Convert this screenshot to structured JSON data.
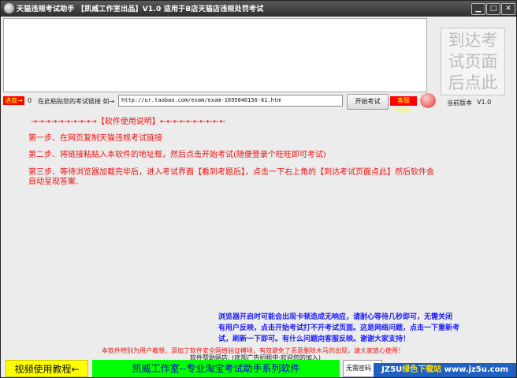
{
  "window": {
    "title": "天猫违规考试助手 【凯威工作室出品】V1.0 适用于B店天猫店违规处罚考试",
    "controls": {
      "minimize": "▁",
      "maximize": "□",
      "close": "✕"
    },
    "app_icon": "cat-app-icon"
  },
  "goto_button": {
    "label": "到达考试页面后点此"
  },
  "toolbar": {
    "progress_label": "进度→",
    "progress_value": "0",
    "paste_hint": "在此粘贴您的考试链接 如→",
    "url_value": "http://ur.taobao.com/exam/exam-1695046156-61.htm",
    "start_button": "开始考试",
    "support_label": "客服QQ→",
    "support_icon": "qq-penguin-icon",
    "version_label": "当前版本",
    "version_value": "V1.0"
  },
  "instructions": {
    "header": "→→→→→→→→→→【软件使用说明】←←←←←←←←←←",
    "step1": "第一步、在网页复制天猫违规考试链接",
    "step2": "第二步、将链接粘贴入本软件的地址框，然后点击开始考试(随便登录个旺旺即可考试)",
    "step3_line1": "第三步、等待浏览器加载完毕后，进入考试界面【看到考题后】，点击一下右上角的【到达考试页面点此】然后软件会",
    "step3_line2": "自动呈现答案."
  },
  "notice": {
    "line1": "浏览器开启时可能会出现卡顿造成无响应，请耐心等待几秒即可，无需关闭",
    "line2": "有用户反映，点击开始考试打不开考试页面。这是网络问题，点击一下重新考",
    "line3": "试，刷新一下即可。有什么问题向客服反映。谢谢大家支持！"
  },
  "footer_note": "本软件特别为用户着想，添加了软件安全网络验证模块，有效避免了恶意删除木马的出现，请大家放心使用！",
  "sponsor": "软件赞助网店: (底部广告招租中·欢迎您的加入)",
  "bottom_bar": {
    "video_button": "视频使用教程←",
    "banner": "凯威工作室--专业淘宝考试助手系列软件",
    "free_button": "无需密码"
  },
  "watermark": {
    "part1": "JZ5U",
    "part2": "绿色下载站",
    "part3": "www.jz5u.com"
  }
}
